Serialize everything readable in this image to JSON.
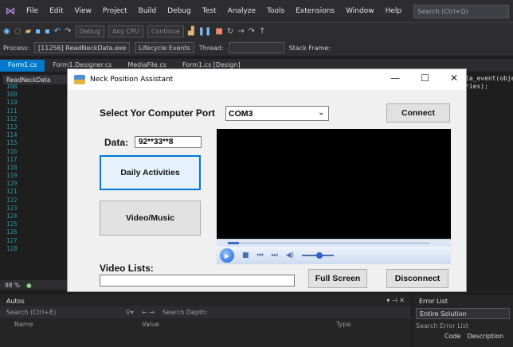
{
  "vs": {
    "menu": [
      "File",
      "Edit",
      "View",
      "Project",
      "Build",
      "Debug",
      "Test",
      "Analyze",
      "Tools",
      "Extensions",
      "Window",
      "Help"
    ],
    "search_placeholder": "Search (Ctrl+Q)",
    "toolbar": {
      "config": "Debug",
      "platform": "Any CPU",
      "continue": "Continue"
    },
    "process_label": "Process:",
    "process_value": "[11256] ReadNeckData.exe",
    "lifecycle": "Lifecycle Events",
    "thread": "Thread:",
    "stack_frame": "Stack Frame:",
    "tabs": [
      {
        "label": "Form1.cs",
        "active": true
      },
      {
        "label": "Form1.Designer.cs",
        "active": false
      },
      {
        "label": "MediaFile.cs",
        "active": false
      },
      {
        "label": "Form1.cs [Design]",
        "active": false
      }
    ],
    "file_dropdown": "ReadNeckData",
    "line_numbers": [
      "108",
      "109",
      "110",
      "111",
      "112",
      "113",
      "114",
      "115",
      "116",
      "117",
      "118",
      "119",
      "120",
      "121",
      "122",
      "123",
      "124",
      "125",
      "126",
      "127",
      "128"
    ],
    "right_code": [
      "ta_event(objec",
      "ries);"
    ],
    "zoom": "98 %",
    "autos": {
      "title": "Autos",
      "search": "Search (Ctrl+E)",
      "search_depth": "Search Depth:",
      "cols": [
        "Name",
        "Value",
        "Type"
      ]
    },
    "errors": {
      "title": "Error List",
      "scope": "Entire Solution",
      "search": "Search Error List",
      "cols": [
        "Code",
        "Description"
      ]
    }
  },
  "dialog": {
    "title": "Neck Position Assistant",
    "select_port_label": "Select Yor Computer Port",
    "port_value": "COM3",
    "connect": "Connect",
    "data_label": "Data:",
    "data_value": "92**33**8",
    "daily_activities": "Daily Activities",
    "video_music": "Video/Music",
    "video_lists": "Video Lists:",
    "full_screen": "Full Screen",
    "disconnect": "Disconnect"
  }
}
